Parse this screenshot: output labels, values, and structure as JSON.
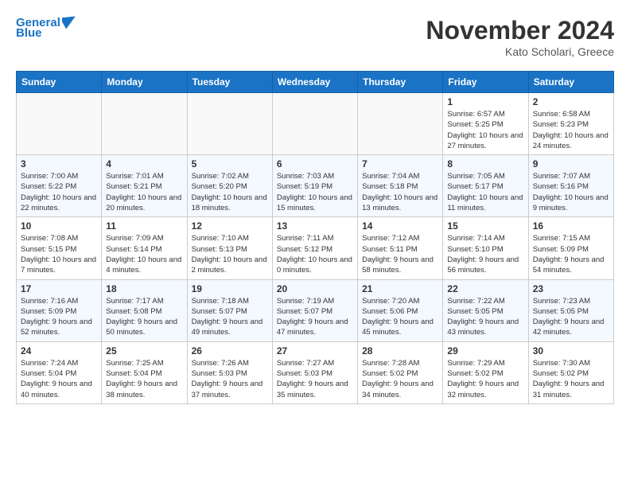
{
  "header": {
    "logo_line1": "General",
    "logo_line2": "Blue",
    "month_title": "November 2024",
    "location": "Kato Scholari, Greece"
  },
  "weekdays": [
    "Sunday",
    "Monday",
    "Tuesday",
    "Wednesday",
    "Thursday",
    "Friday",
    "Saturday"
  ],
  "weeks": [
    [
      {
        "day": "",
        "info": ""
      },
      {
        "day": "",
        "info": ""
      },
      {
        "day": "",
        "info": ""
      },
      {
        "day": "",
        "info": ""
      },
      {
        "day": "",
        "info": ""
      },
      {
        "day": "1",
        "info": "Sunrise: 6:57 AM\nSunset: 5:25 PM\nDaylight: 10 hours and 27 minutes."
      },
      {
        "day": "2",
        "info": "Sunrise: 6:58 AM\nSunset: 5:23 PM\nDaylight: 10 hours and 24 minutes."
      }
    ],
    [
      {
        "day": "3",
        "info": "Sunrise: 7:00 AM\nSunset: 5:22 PM\nDaylight: 10 hours and 22 minutes."
      },
      {
        "day": "4",
        "info": "Sunrise: 7:01 AM\nSunset: 5:21 PM\nDaylight: 10 hours and 20 minutes."
      },
      {
        "day": "5",
        "info": "Sunrise: 7:02 AM\nSunset: 5:20 PM\nDaylight: 10 hours and 18 minutes."
      },
      {
        "day": "6",
        "info": "Sunrise: 7:03 AM\nSunset: 5:19 PM\nDaylight: 10 hours and 15 minutes."
      },
      {
        "day": "7",
        "info": "Sunrise: 7:04 AM\nSunset: 5:18 PM\nDaylight: 10 hours and 13 minutes."
      },
      {
        "day": "8",
        "info": "Sunrise: 7:05 AM\nSunset: 5:17 PM\nDaylight: 10 hours and 11 minutes."
      },
      {
        "day": "9",
        "info": "Sunrise: 7:07 AM\nSunset: 5:16 PM\nDaylight: 10 hours and 9 minutes."
      }
    ],
    [
      {
        "day": "10",
        "info": "Sunrise: 7:08 AM\nSunset: 5:15 PM\nDaylight: 10 hours and 7 minutes."
      },
      {
        "day": "11",
        "info": "Sunrise: 7:09 AM\nSunset: 5:14 PM\nDaylight: 10 hours and 4 minutes."
      },
      {
        "day": "12",
        "info": "Sunrise: 7:10 AM\nSunset: 5:13 PM\nDaylight: 10 hours and 2 minutes."
      },
      {
        "day": "13",
        "info": "Sunrise: 7:11 AM\nSunset: 5:12 PM\nDaylight: 10 hours and 0 minutes."
      },
      {
        "day": "14",
        "info": "Sunrise: 7:12 AM\nSunset: 5:11 PM\nDaylight: 9 hours and 58 minutes."
      },
      {
        "day": "15",
        "info": "Sunrise: 7:14 AM\nSunset: 5:10 PM\nDaylight: 9 hours and 56 minutes."
      },
      {
        "day": "16",
        "info": "Sunrise: 7:15 AM\nSunset: 5:09 PM\nDaylight: 9 hours and 54 minutes."
      }
    ],
    [
      {
        "day": "17",
        "info": "Sunrise: 7:16 AM\nSunset: 5:09 PM\nDaylight: 9 hours and 52 minutes."
      },
      {
        "day": "18",
        "info": "Sunrise: 7:17 AM\nSunset: 5:08 PM\nDaylight: 9 hours and 50 minutes."
      },
      {
        "day": "19",
        "info": "Sunrise: 7:18 AM\nSunset: 5:07 PM\nDaylight: 9 hours and 49 minutes."
      },
      {
        "day": "20",
        "info": "Sunrise: 7:19 AM\nSunset: 5:07 PM\nDaylight: 9 hours and 47 minutes."
      },
      {
        "day": "21",
        "info": "Sunrise: 7:20 AM\nSunset: 5:06 PM\nDaylight: 9 hours and 45 minutes."
      },
      {
        "day": "22",
        "info": "Sunrise: 7:22 AM\nSunset: 5:05 PM\nDaylight: 9 hours and 43 minutes."
      },
      {
        "day": "23",
        "info": "Sunrise: 7:23 AM\nSunset: 5:05 PM\nDaylight: 9 hours and 42 minutes."
      }
    ],
    [
      {
        "day": "24",
        "info": "Sunrise: 7:24 AM\nSunset: 5:04 PM\nDaylight: 9 hours and 40 minutes."
      },
      {
        "day": "25",
        "info": "Sunrise: 7:25 AM\nSunset: 5:04 PM\nDaylight: 9 hours and 38 minutes."
      },
      {
        "day": "26",
        "info": "Sunrise: 7:26 AM\nSunset: 5:03 PM\nDaylight: 9 hours and 37 minutes."
      },
      {
        "day": "27",
        "info": "Sunrise: 7:27 AM\nSunset: 5:03 PM\nDaylight: 9 hours and 35 minutes."
      },
      {
        "day": "28",
        "info": "Sunrise: 7:28 AM\nSunset: 5:02 PM\nDaylight: 9 hours and 34 minutes."
      },
      {
        "day": "29",
        "info": "Sunrise: 7:29 AM\nSunset: 5:02 PM\nDaylight: 9 hours and 32 minutes."
      },
      {
        "day": "30",
        "info": "Sunrise: 7:30 AM\nSunset: 5:02 PM\nDaylight: 9 hours and 31 minutes."
      }
    ]
  ]
}
